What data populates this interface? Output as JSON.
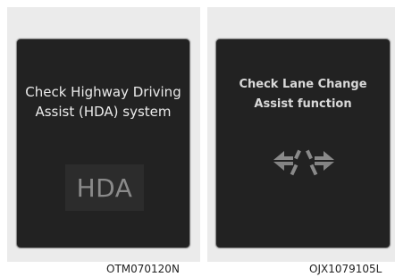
{
  "panels": [
    {
      "message_line1": "Check Highway Driving",
      "message_line2": "Assist (HDA) system",
      "icon_text": "HDA",
      "code": "OTM070120N"
    },
    {
      "message_line1": "Check Lane Change",
      "message_line2": "Assist function",
      "icon": "lane-change-arrows-icon",
      "code": "OJX1079105L"
    }
  ],
  "colors": {
    "screen_bg": "#222222",
    "panel_bg": "#ebebeb",
    "text": "#ebebeb",
    "icon_gray": "#8a8a8a"
  }
}
